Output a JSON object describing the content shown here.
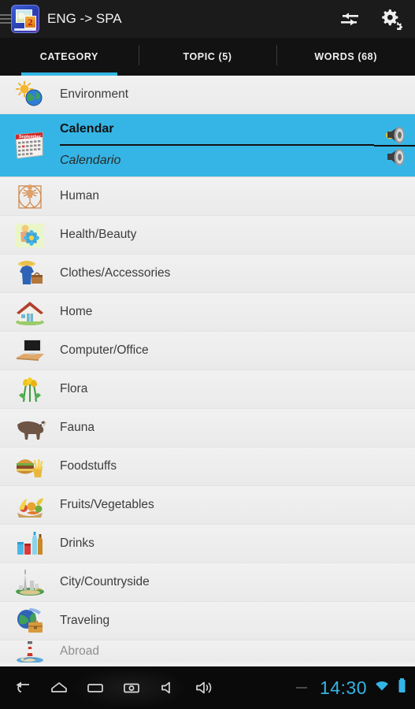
{
  "actionbar": {
    "title": "ENG -> SPA",
    "menu_icon": "hamburger-icon",
    "app_icon": "app-logo-icon",
    "app_icon_badge": "2",
    "swap_icon": "swap-languages-icon",
    "settings_icon": "settings-gear-icon"
  },
  "tabs": [
    {
      "label": "CATEGORY",
      "active": true
    },
    {
      "label": "TOPIC (5)",
      "active": false
    },
    {
      "label": "WORDS (68)",
      "active": false
    }
  ],
  "selected": {
    "source": "Calendar",
    "target": "Calendario",
    "icon": "calendar-icon",
    "speaker_source_icon": "speaker-source-icon",
    "speaker_target_icon": "speaker-target-icon"
  },
  "list": [
    {
      "label": "Environment",
      "icon": "sun-globe-icon",
      "selected": false,
      "partial": false
    },
    {
      "label": "Calendar",
      "icon": "calendar-icon",
      "selected": true,
      "partial": false
    },
    {
      "label": "Human",
      "icon": "vitruvian-man-icon",
      "selected": false,
      "partial": false
    },
    {
      "label": "Health/Beauty",
      "icon": "flower-beauty-icon",
      "selected": false,
      "partial": false
    },
    {
      "label": "Clothes/Accessories",
      "icon": "clothes-icon",
      "selected": false,
      "partial": false
    },
    {
      "label": "Home",
      "icon": "house-icon",
      "selected": false,
      "partial": false
    },
    {
      "label": "Computer/Office",
      "icon": "computer-icon",
      "selected": false,
      "partial": false
    },
    {
      "label": "Flora",
      "icon": "tulips-icon",
      "selected": false,
      "partial": false
    },
    {
      "label": "Fauna",
      "icon": "rhino-icon",
      "selected": false,
      "partial": false
    },
    {
      "label": "Foodstuffs",
      "icon": "burger-fries-icon",
      "selected": false,
      "partial": false
    },
    {
      "label": "Fruits/Vegetables",
      "icon": "produce-icon",
      "selected": false,
      "partial": false
    },
    {
      "label": "Drinks",
      "icon": "bottles-icon",
      "selected": false,
      "partial": false
    },
    {
      "label": "City/Countryside",
      "icon": "city-icon",
      "selected": false,
      "partial": false
    },
    {
      "label": "Traveling",
      "icon": "suitcase-globe-icon",
      "selected": false,
      "partial": false
    },
    {
      "label": "Abroad",
      "icon": "lighthouse-icon",
      "selected": false,
      "partial": true
    }
  ],
  "navbar": {
    "back_icon": "back-icon",
    "home_icon": "home-icon",
    "recents_icon": "recents-icon",
    "screenshot_icon": "screenshot-icon",
    "volume_down_icon": "volume-down-icon",
    "volume_up_icon": "volume-up-icon",
    "clock": "14:30",
    "wifi_icon": "wifi-icon",
    "battery_icon": "battery-full-icon"
  },
  "colors": {
    "accent": "#35b5e5",
    "actionbar_bg": "#1b1b1b",
    "tabbar_bg": "#121212",
    "list_bg": "#efefef",
    "navbar_bg": "#0a0a0a",
    "clock": "#33b5e5"
  }
}
